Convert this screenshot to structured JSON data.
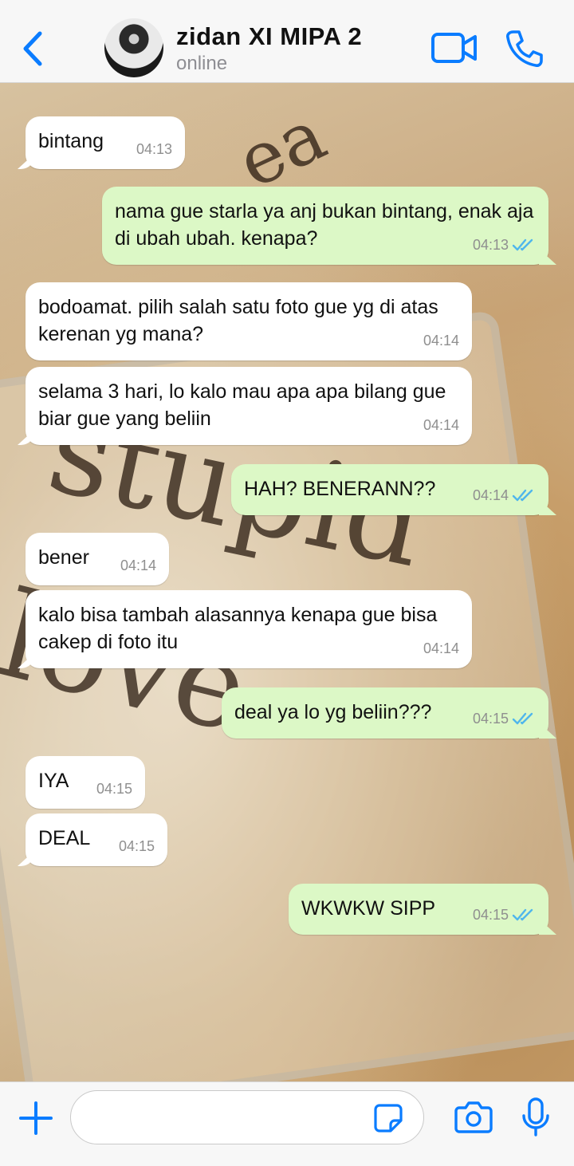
{
  "header": {
    "contact_name": "zidan XI MIPA 2",
    "status": "online"
  },
  "wallpaper": {
    "words": [
      "ea",
      "stupid",
      "love"
    ]
  },
  "messages": [
    {
      "dir": "in",
      "text": "bintang",
      "time": "04:13"
    },
    {
      "dir": "out",
      "text": "nama gue starla ya anj bukan bintang, enak aja di ubah ubah. kenapa?",
      "time": "04:13",
      "read": true
    },
    {
      "dir": "in",
      "text": "bodoamat. pilih salah satu foto gue yg di atas kerenan yg mana?",
      "time": "04:14"
    },
    {
      "dir": "in",
      "text": "selama 3 hari, lo kalo mau apa apa bilang gue biar gue yang beliin",
      "time": "04:14"
    },
    {
      "dir": "out",
      "text": "HAH? BENERANN??",
      "time": "04:14",
      "read": true
    },
    {
      "dir": "in",
      "text": "bener",
      "time": "04:14"
    },
    {
      "dir": "in",
      "text": "kalo bisa tambah alasannya kenapa gue bisa cakep di foto itu",
      "time": "04:14"
    },
    {
      "dir": "out",
      "text": "deal ya lo yg beliin???",
      "time": "04:15",
      "read": true
    },
    {
      "dir": "in",
      "text": "IYA",
      "time": "04:15"
    },
    {
      "dir": "in",
      "text": "DEAL",
      "time": "04:15"
    },
    {
      "dir": "out",
      "text": "WKWKW SIPP",
      "time": "04:15",
      "read": true
    }
  ],
  "composer": {
    "value": "",
    "placeholder": ""
  },
  "colors": {
    "accent": "#0a7cff",
    "outgoing_bubble": "#dcf8c6",
    "incoming_bubble": "#ffffff",
    "read_tick": "#4fb6ec"
  }
}
